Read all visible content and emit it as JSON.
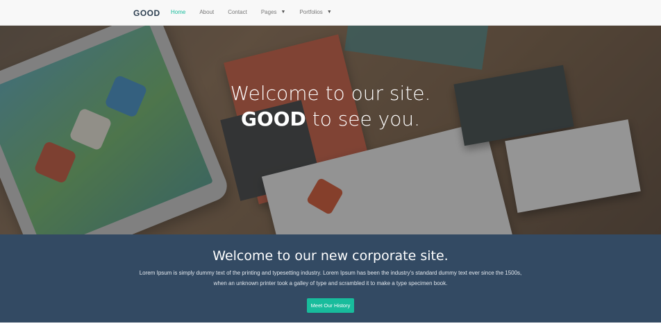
{
  "navbar": {
    "brand": "GOOD",
    "items": [
      {
        "label": "Home",
        "active": true,
        "dropdown": false
      },
      {
        "label": "About",
        "active": false,
        "dropdown": false
      },
      {
        "label": "Contact",
        "active": false,
        "dropdown": false
      },
      {
        "label": "Pages",
        "active": false,
        "dropdown": true
      },
      {
        "label": "Portfolios",
        "active": false,
        "dropdown": true
      }
    ],
    "caret_icon": "▼"
  },
  "hero": {
    "line1": "Welcome to our site.",
    "line2_strong": "GOOD",
    "line2_rest": " to see you."
  },
  "welcome": {
    "title": "Welcome to our new corporate site.",
    "text": "Lorem Ipsum is simply dummy text of the printing and typesetting industry. Lorem Ipsum has been the industry's standard dummy text ever since the 1500s, when an unknown printer took a galley of type and scrambled it to make a type specimen book.",
    "button_label": "Meet Our History"
  },
  "colors": {
    "accent": "#18bc9c",
    "brand": "#2c3e50",
    "band": "#334a63"
  }
}
